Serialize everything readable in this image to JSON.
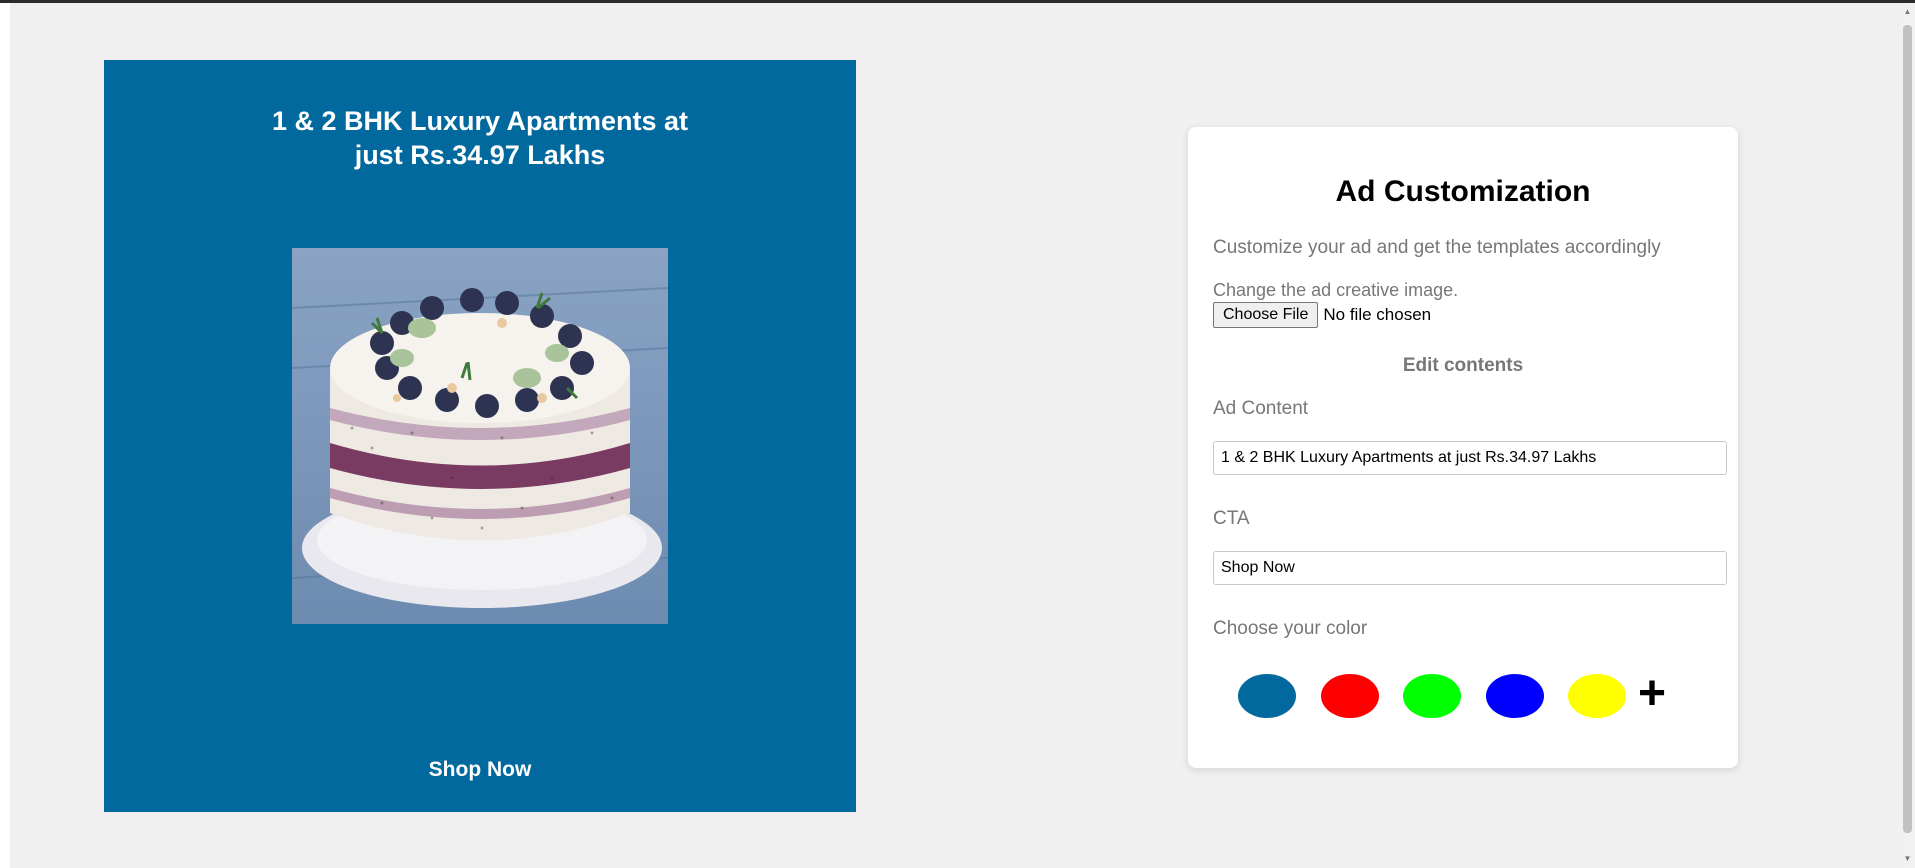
{
  "ad": {
    "background_color": "#02699e",
    "headline_lines": [
      "1 & 2 BHK Luxury Apartments at",
      "just Rs.34.97 Lakhs"
    ],
    "image": "cake-photo",
    "cta": "Shop Now"
  },
  "panel": {
    "title": "Ad Customization",
    "description": "Customize your ad and get the templates accordingly",
    "image_label": "Change the ad creative image.",
    "file_button": "Choose File",
    "file_status": "No file chosen",
    "edit_heading": "Edit contents",
    "ad_content_label": "Ad Content",
    "ad_content_value": "1 & 2 BHK Luxury Apartments at just Rs.34.97 Lakhs",
    "cta_label": "CTA",
    "cta_value": "Shop Now",
    "color_label": "Choose your color",
    "colors": [
      "#02699e",
      "#ff0000",
      "#00ff00",
      "#0000ff",
      "#ffff00"
    ],
    "add_color_icon": "plus-icon"
  }
}
